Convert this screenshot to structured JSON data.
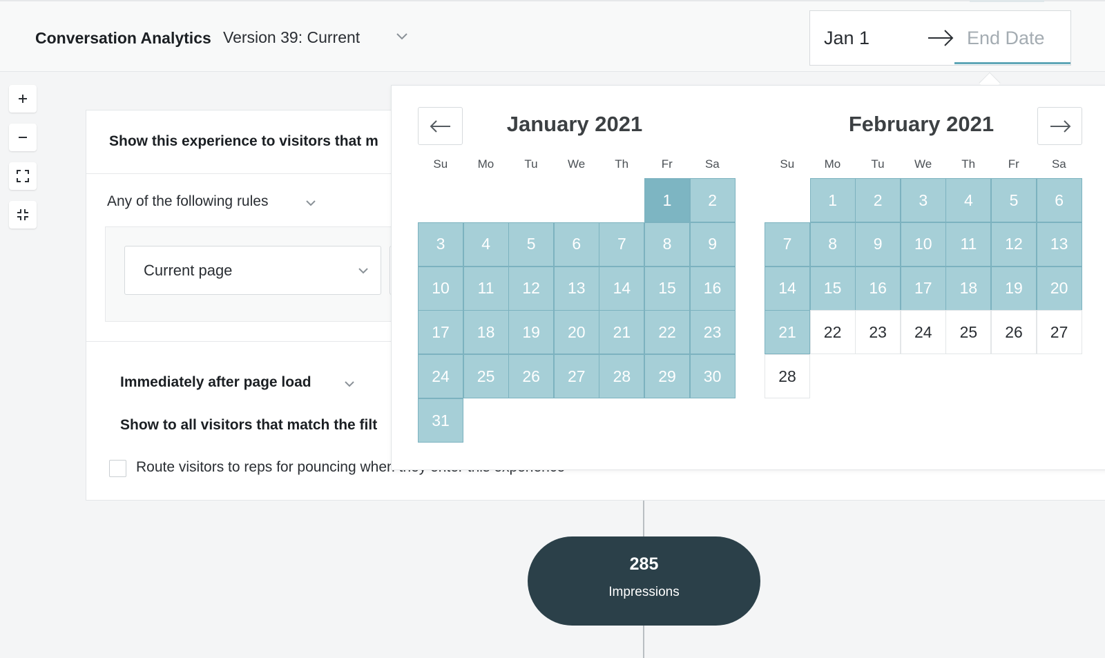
{
  "header": {
    "app_title": "Conversation Analytics",
    "version_label": "Version 39: Current"
  },
  "date_range": {
    "start": "Jan 1",
    "end_placeholder": "End Date"
  },
  "zoom_controls": [
    "zoom-in",
    "zoom-out",
    "expand",
    "collapse"
  ],
  "card": {
    "title": "Show this experience to visitors that m",
    "rules_select": "Any of the following rules",
    "page_select": "Current page",
    "timing": "Immediately after page load",
    "show_all": "Show to all visitors that match the filt",
    "route_label": "Route visitors to reps for pouncing when they enter this experience",
    "route_checked": false
  },
  "impressions": {
    "count": "285",
    "label": "Impressions"
  },
  "calendar": {
    "left": {
      "title": "January 2021",
      "dow": [
        "Su",
        "Mo",
        "Tu",
        "We",
        "Th",
        "Fr",
        "Sa"
      ],
      "first_weekday": 5,
      "days": 31,
      "range_start": 1,
      "selected_through": 31
    },
    "right": {
      "title": "February 2021",
      "dow": [
        "Su",
        "Mo",
        "Tu",
        "We",
        "Th",
        "Fr",
        "Sa"
      ],
      "first_weekday": 1,
      "days": 28,
      "selected_through": 21
    }
  },
  "colors": {
    "accent": "#5fa6b6",
    "selected_day": "#a6cfd7",
    "range_start_day": "#7db5c2",
    "impressions_bg": "#2b4049"
  }
}
